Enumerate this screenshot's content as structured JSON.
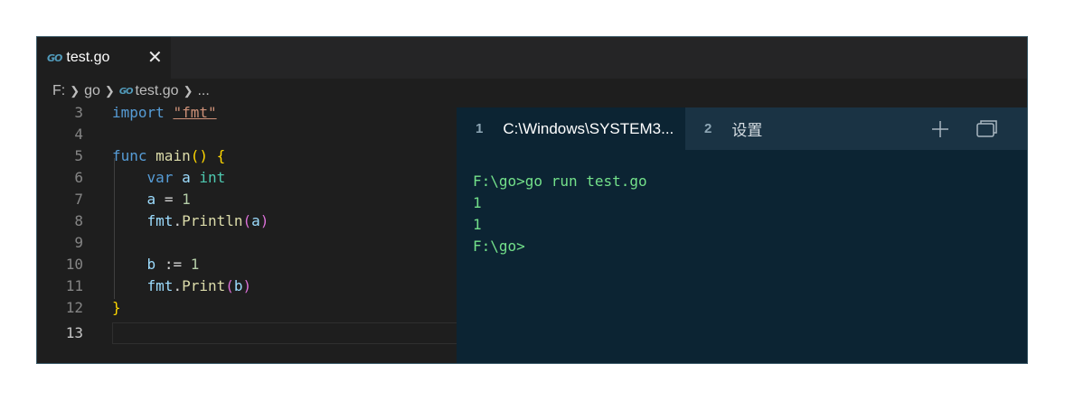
{
  "editor": {
    "tab": {
      "icon": "go-file-icon",
      "icon_text": "GO",
      "label": "test.go",
      "close": "✕"
    },
    "breadcrumb": {
      "drive": "F:",
      "folder": "go",
      "file": "test.go",
      "more": "..."
    },
    "lines": [
      {
        "number": "3"
      },
      {
        "number": "4"
      },
      {
        "number": "5"
      },
      {
        "number": "6"
      },
      {
        "number": "7"
      },
      {
        "number": "8"
      },
      {
        "number": "9"
      },
      {
        "number": "10"
      },
      {
        "number": "11"
      },
      {
        "number": "12"
      },
      {
        "number": "13"
      }
    ],
    "tokens": {
      "import_kw": "import",
      "import_path": "\"fmt\"",
      "func_kw": "func",
      "main_name": "main",
      "paren_open_close": "()",
      "brace_open": "{",
      "var_kw": "var",
      "a": "a",
      "int_type": "int",
      "assign": "=",
      "one": "1",
      "fmt": "fmt",
      "println": "Println",
      "paren_open": "(",
      "paren_close": ")",
      "b": "b",
      "short_assign": ":=",
      "print": "Print",
      "brace_close": "}",
      "dot": "."
    }
  },
  "terminal": {
    "tabs": [
      {
        "num": "1",
        "label": "C:\\Windows\\SYSTEM3..."
      },
      {
        "num": "2",
        "label": "设置"
      }
    ],
    "actions": {
      "add": "plus-icon",
      "restore": "restore-window-icon"
    },
    "output": [
      "F:\\go>go run test.go",
      "1",
      "1",
      "F:\\go>"
    ]
  },
  "colors": {
    "editor_bg": "#1e1e1e",
    "terminal_bg": "#0c2433",
    "terminal_text": "#73e08a",
    "keyword": "#569cd6",
    "string": "#ce9178",
    "function": "#dcdcaa",
    "variable": "#9cdcfe",
    "type": "#4ec9b0"
  }
}
